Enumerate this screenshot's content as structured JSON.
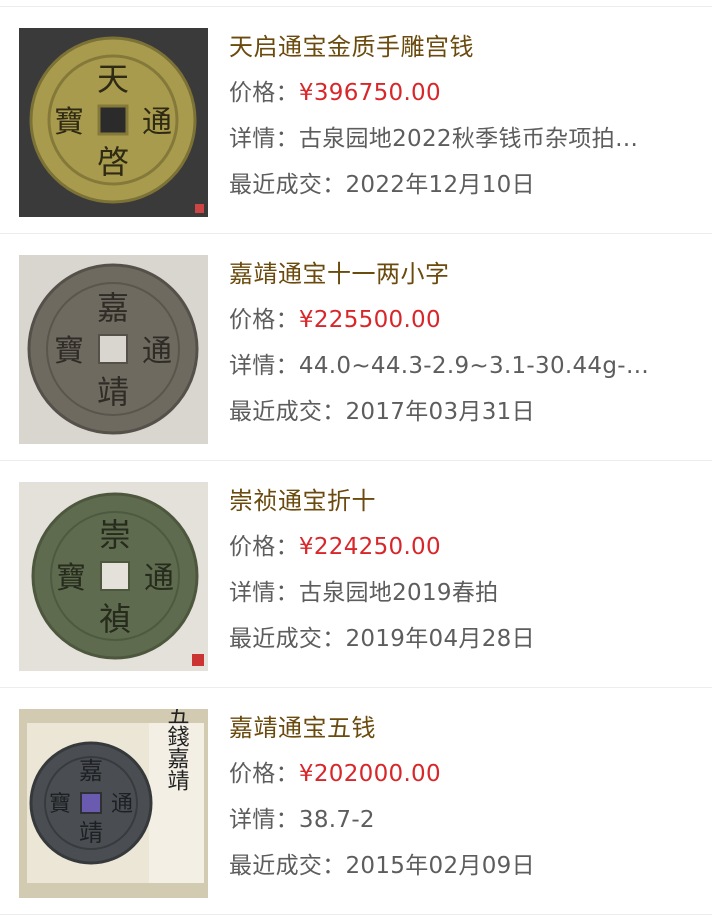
{
  "labels": {
    "price": "价格：",
    "detail": "详情：",
    "recent": "最近成交："
  },
  "items": [
    {
      "title": "天启通宝金质手雕宫钱",
      "price": "¥396750.00",
      "detail": "古泉园地2022秋季钱币杂项拍…",
      "date": "2022年12月10日",
      "coin": {
        "top": "天",
        "bottom": "啓",
        "left": "寶",
        "right": "通",
        "metal": "#a99b4e",
        "bg": "#3a3a3a"
      }
    },
    {
      "title": "嘉靖通宝十一两小字",
      "price": "¥225500.00",
      "detail": "44.0~44.3-2.9~3.1-30.44g-…",
      "date": "2017年03月31日",
      "coin": {
        "top": "嘉",
        "bottom": "靖",
        "left": "寶",
        "right": "通",
        "metal": "#6f6a5f",
        "bg": "#d9d6d0"
      }
    },
    {
      "title": "崇祯通宝折十",
      "price": "¥224250.00",
      "detail": "古泉园地2019春拍",
      "date": "2019年04月28日",
      "coin": {
        "top": "崇",
        "bottom": "禎",
        "left": "寶",
        "right": "通",
        "metal": "#5f6b4e",
        "bg": "#e4e0da"
      }
    },
    {
      "title": "嘉靖通宝五钱",
      "price": "¥202000.00",
      "detail": "38.7-2",
      "date": "2015年02月09日",
      "coin": {
        "top": "嘉",
        "bottom": "靖",
        "left": "寶",
        "right": "通",
        "metal": "#4a4e52",
        "bg": "#e9e3d3",
        "tag": "五錢嘉靖"
      }
    }
  ]
}
